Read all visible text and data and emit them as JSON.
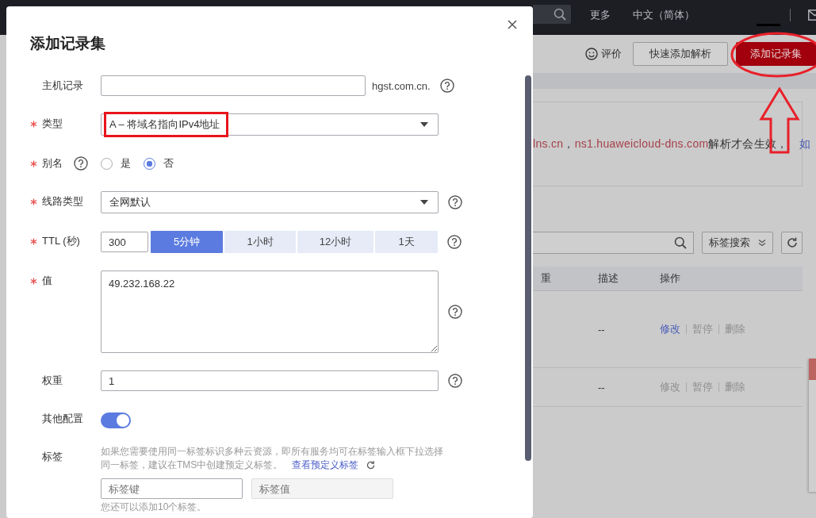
{
  "top_bar": {
    "menu": [
      {
        "label": "更多"
      },
      {
        "label": "中文（简体）"
      }
    ]
  },
  "toolbar": {
    "rate_label": "评价",
    "buttons": [
      {
        "label": "快速添加解析",
        "kind": "default"
      },
      {
        "label": "添加记录集",
        "kind": "primary"
      }
    ]
  },
  "notice": {
    "parts": [
      {
        "text": "lns.cn",
        "kind": "highlight"
      },
      {
        "text": "，",
        "kind": "plain"
      },
      {
        "text": "ns1.huaweicloud-dns.com",
        "kind": "highlight"
      },
      {
        "text": "解析才会生效，",
        "kind": "plain"
      },
      {
        "text": "如",
        "kind": "link"
      }
    ]
  },
  "search": {
    "tag_search_label": "标签搜索"
  },
  "table": {
    "columns": [
      "重",
      "描述",
      "操作"
    ],
    "rows": [
      {
        "description": "--",
        "actions": [
          {
            "label": "修改",
            "disabled": false
          },
          {
            "label": "暂停",
            "disabled": true
          },
          {
            "label": "删除",
            "disabled": true
          }
        ]
      },
      {
        "description": "--",
        "actions": [
          {
            "label": "修改",
            "disabled": true
          },
          {
            "label": "暂停",
            "disabled": true
          },
          {
            "label": "删除",
            "disabled": true
          }
        ]
      }
    ]
  },
  "dialog": {
    "title": "添加记录集",
    "rows": [
      {
        "kind": "input",
        "label": "主机记录",
        "required": false,
        "suffix": "hgst.com.cn.",
        "help": true
      },
      {
        "kind": "select",
        "label": "类型",
        "required": true,
        "value": "A – 将域名指向IPv4地址",
        "highlighted": true
      },
      {
        "kind": "radio",
        "label": "别名",
        "required": true,
        "label_help": true,
        "options": [
          {
            "label": "是",
            "selected": false
          },
          {
            "label": "否",
            "selected": true
          }
        ]
      },
      {
        "kind": "select",
        "label": "线路类型",
        "required": true,
        "value": "全网默认",
        "highlighted": false,
        "help": true
      },
      {
        "kind": "ttl",
        "label": "TTL (秒)",
        "required": true,
        "value": "300",
        "help": true,
        "presets": [
          {
            "label": "5分钟",
            "selected": true
          },
          {
            "label": "1小时",
            "selected": false
          },
          {
            "label": "12小时",
            "selected": false
          },
          {
            "label": "1天",
            "selected": false
          }
        ]
      },
      {
        "kind": "textarea",
        "label": "值",
        "required": true,
        "value": "49.232.168.22",
        "help": true
      },
      {
        "kind": "input",
        "label": "权重",
        "required": false,
        "value": "1",
        "help": true
      },
      {
        "kind": "toggle",
        "label": "其他配置",
        "required": false,
        "on": true
      },
      {
        "kind": "tags",
        "label": "标签",
        "required": false,
        "hint_lines": [
          "如果您需要使用同一标签标识多种云资源，即所有服务均可在标签输入框下拉选择",
          "同一标签，建议在TMS中创建预定义标签。"
        ],
        "link": "查看预定义标签",
        "key_placeholder": "标签键",
        "value_placeholder": "标签值",
        "value_disabled": true,
        "remaining": "您还可以添加10个标签。"
      }
    ]
  }
}
